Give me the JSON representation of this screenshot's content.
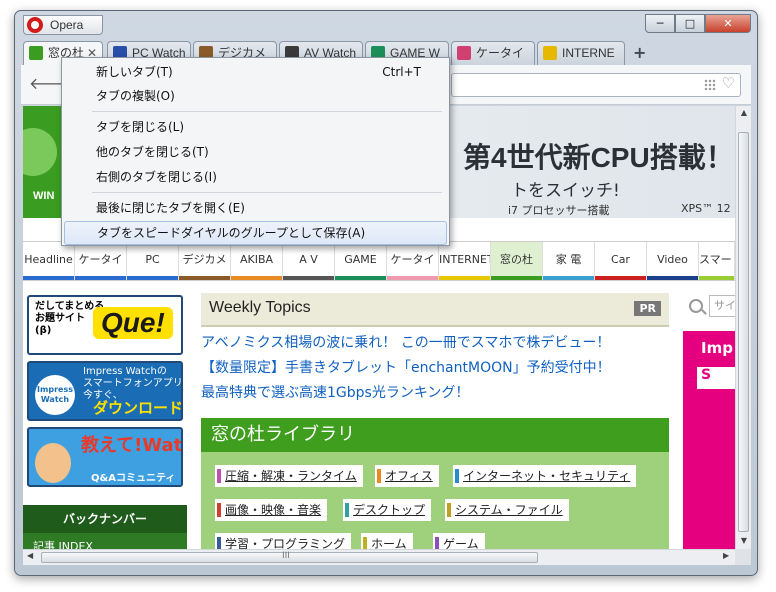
{
  "window": {
    "app_title": "Opera",
    "controls": {
      "minimize": "─",
      "maximize": "□",
      "close": "✕"
    }
  },
  "tabs": [
    {
      "label": "窓の杜",
      "favicon_color": "#3a9c21",
      "active": true
    },
    {
      "label": "PC Watch",
      "favicon_color": "#2a4fa8"
    },
    {
      "label": "デジカメ",
      "favicon_color": "#8a5a2a"
    },
    {
      "label": "AV Watch",
      "favicon_color": "#3a3a3a"
    },
    {
      "label": "GAME W",
      "favicon_color": "#1a8f5a"
    },
    {
      "label": "ケータイ",
      "favicon_color": "#d04070"
    },
    {
      "label": "INTERNE",
      "favicon_color": "#e6b800"
    }
  ],
  "tab_close_symbol": "✕",
  "new_tab_symbol": "+",
  "toolbar": {
    "back_symbol": "🡐",
    "heart_symbol": "♡"
  },
  "banner": {
    "win_text": "WIN",
    "headline": "第4世代新CPU搭載！",
    "subline": "トをスイッチ!",
    "cpu_text": "i7 プロセッサー搭載",
    "xps_text": "XPS™ 12"
  },
  "nav": [
    {
      "label": "Headline",
      "color": "#2a6bd0"
    },
    {
      "label": "ケータイ",
      "color": "#2a6bd0"
    },
    {
      "label": "PC",
      "color": "#2a6bd0"
    },
    {
      "label": "デジカメ",
      "color": "#8a5a2a"
    },
    {
      "label": "AKIBA",
      "color": "#e88a20"
    },
    {
      "label": "A V",
      "color": "#555555"
    },
    {
      "label": "GAME",
      "color": "#1a8f5a"
    },
    {
      "label": "ケータイ",
      "color": "#f09ab0"
    },
    {
      "label": "INTERNET",
      "color": "#e6c800"
    },
    {
      "label": "窓の杜",
      "color": "#3a9c21"
    },
    {
      "label": "家 電",
      "color": "#3aa0d0"
    },
    {
      "label": "Car",
      "color": "#cc2020"
    },
    {
      "label": "Video",
      "color": "#1a3f8a"
    },
    {
      "label": "スマートフ",
      "color": "#9acd32"
    }
  ],
  "left_banners": {
    "que_text1": "だしてまとめる",
    "que_text2": "お題サイト",
    "que_text3": "(β)",
    "que_logo": "Que!",
    "iw_logo1": "Impress",
    "iw_logo2": "Watch",
    "iw_text1": "Impress Watchの",
    "iw_text2": "スマートフォンアプリ",
    "iw_text3": "今すぐ、",
    "iw_download": "ダウンロード!",
    "qa_title": "教えて!Watch",
    "qa_sub": "Q&Aコミュニティ",
    "back_number": "バックナンバー",
    "kiji_index": "記事 INDEX"
  },
  "weekly": {
    "title": "Weekly Topics",
    "pr": "PR",
    "links": [
      "アベノミクス相場の波に乗れ！ この一冊でスマホで株デビュー！",
      "【数量限定】手書きタブレット「enchantMOON」予約受付中！",
      "最高特典で選ぶ高速1Gbps光ランキング！"
    ]
  },
  "library": {
    "title": "窓の杜ライブラリ",
    "chips": [
      {
        "label": "圧縮・解凍・ランタイム",
        "color": "#c050b0"
      },
      {
        "label": "オフィス",
        "color": "#e88a20"
      },
      {
        "label": "インターネット・セキュリティ",
        "color": "#2a8ad0"
      },
      {
        "label": "画像・映像・音楽",
        "color": "#d04030"
      },
      {
        "label": "デスクトップ",
        "color": "#30a0a0"
      },
      {
        "label": "システム・ファイル",
        "color": "#c0a020"
      },
      {
        "label": "学習・プログラミング",
        "color": "#3a5a9a"
      },
      {
        "label": "ホーム",
        "color": "#c0b020"
      },
      {
        "label": "ゲーム",
        "color": "#8a50c0"
      }
    ]
  },
  "search": {
    "placeholder": "サイ"
  },
  "right_ad": {
    "text": "Imp",
    "box": "S"
  },
  "context_menu": {
    "items": [
      {
        "label": "新しいタブ(T)",
        "shortcut": "Ctrl+T"
      },
      {
        "label": "タブの複製(O)"
      },
      {
        "label": "タブを閉じる(L)"
      },
      {
        "label": "他のタブを閉じる(T)"
      },
      {
        "label": "右側のタブを閉じる(I)"
      },
      {
        "label": "最後に閉じたタブを開く(E)"
      },
      {
        "label": "タブをスピードダイヤルのグループとして保存(A)",
        "highlighted": true
      }
    ]
  },
  "scroll": {
    "grip": "III",
    "up": "▲",
    "down": "▼",
    "left": "◀",
    "right": "▶"
  }
}
